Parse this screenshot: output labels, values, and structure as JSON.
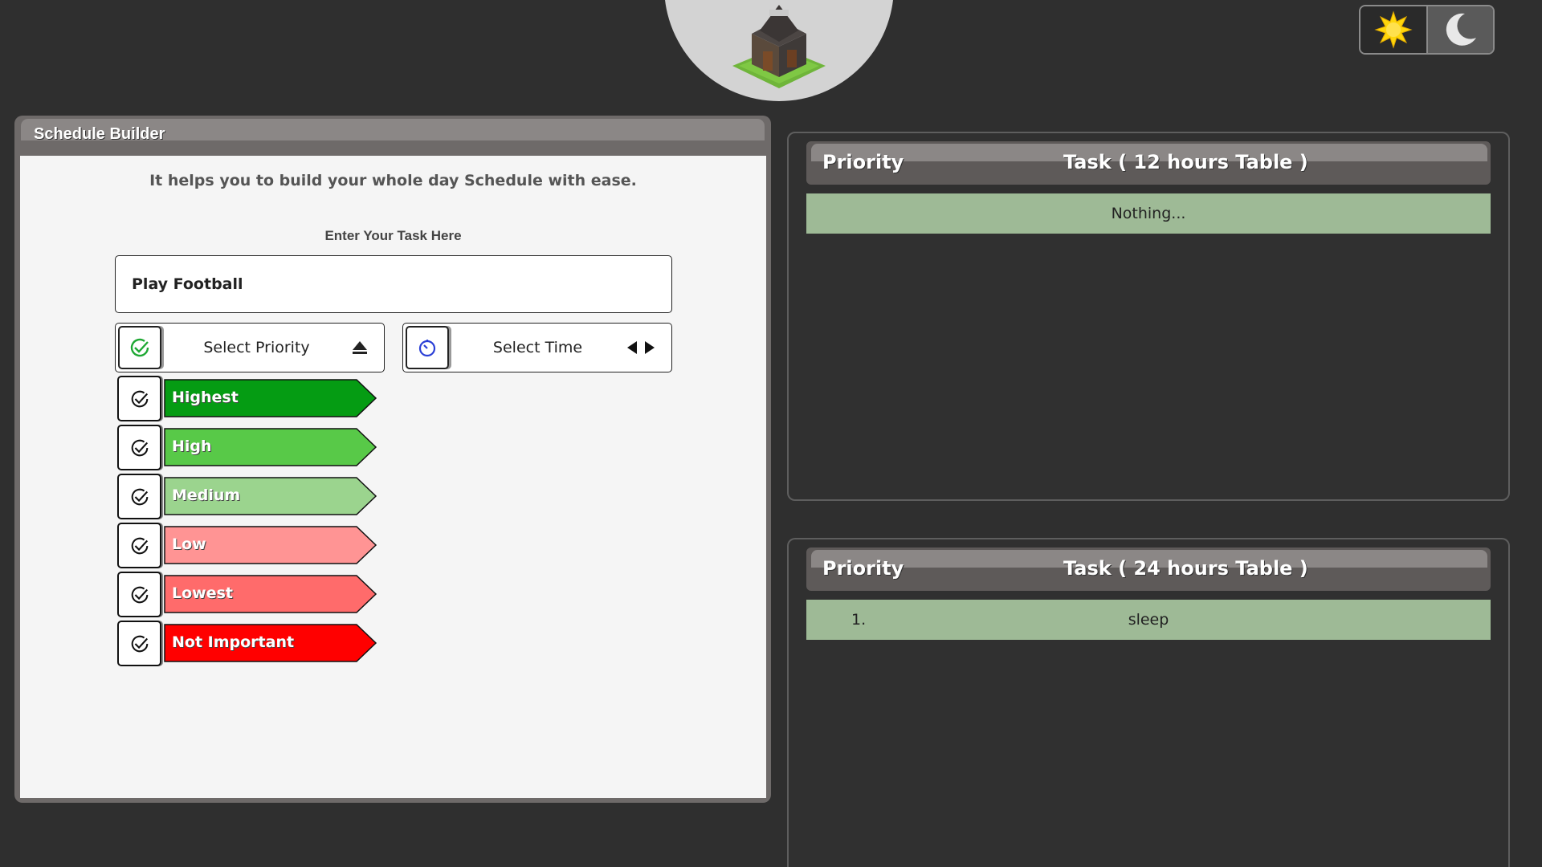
{
  "header": {
    "logo_icon": "builder-hut-icon",
    "theme_toggle": {
      "light_icon": "sun-icon",
      "dark_icon": "moon-icon",
      "active": "dark"
    }
  },
  "builder": {
    "title": "Schedule Builder",
    "description": "It helps you to build your whole day Schedule with ease.",
    "task_label": "Enter Your Task Here",
    "task_value": "Play Football",
    "priority_select": {
      "label": "Select Priority",
      "icon": "check-circle-icon",
      "arrow": "eject-up-icon"
    },
    "time_select": {
      "label": "Select Time",
      "icon": "timer-icon",
      "arrows": [
        "left-arrow-icon",
        "right-arrow-icon"
      ]
    },
    "priorities": [
      {
        "label": "Highest",
        "color": "#059c13"
      },
      {
        "label": "High",
        "color": "#58c948"
      },
      {
        "label": "Medium",
        "color": "#9bd48e"
      },
      {
        "label": "Low",
        "color": "#ff9494"
      },
      {
        "label": "Lowest",
        "color": "#ff6b6b"
      },
      {
        "label": "Not Important",
        "color": "#ff0000"
      }
    ]
  },
  "tables": {
    "twelve": {
      "col_priority": "Priority",
      "col_task": "Task ( 12 hours Table )",
      "rows": [
        {
          "num": "",
          "text": "Nothing..."
        }
      ]
    },
    "twentyfour": {
      "col_priority": "Priority",
      "col_task": "Task ( 24 hours Table )",
      "rows": [
        {
          "num": "1.",
          "text": "sleep"
        }
      ]
    }
  }
}
